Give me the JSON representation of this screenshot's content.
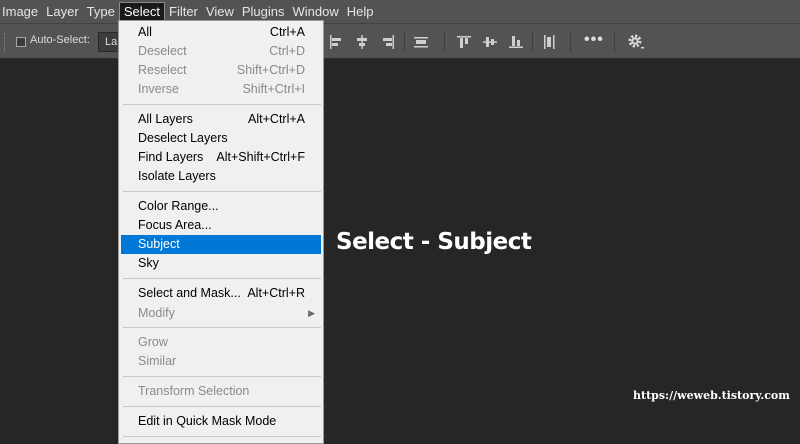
{
  "menubar": {
    "items": [
      "Image",
      "Layer",
      "Type",
      "Select",
      "Filter",
      "View",
      "Plugins",
      "Window",
      "Help"
    ],
    "active": "Select"
  },
  "options_bar": {
    "auto_select_label": "Auto-Select:",
    "auto_select_checked": false,
    "target_dropdown_value": "La",
    "more_label": "•••",
    "icons": [
      "align-left-edges-icon",
      "align-horizontal-centers-icon",
      "align-right-edges-icon",
      "distribute-horizontal-icon",
      "align-top-edges-icon",
      "align-vertical-centers-icon",
      "align-bottom-edges-icon",
      "distribute-vertical-icon",
      "more-icon",
      "gear-icon"
    ]
  },
  "select_menu": {
    "items": [
      {
        "label": "All",
        "shortcut": "Ctrl+A",
        "disabled": false
      },
      {
        "label": "Deselect",
        "shortcut": "Ctrl+D",
        "disabled": true
      },
      {
        "label": "Reselect",
        "shortcut": "Shift+Ctrl+D",
        "disabled": true
      },
      {
        "label": "Inverse",
        "shortcut": "Shift+Ctrl+I",
        "disabled": true
      },
      {
        "label": "All Layers",
        "shortcut": "Alt+Ctrl+A",
        "disabled": false
      },
      {
        "label": "Deselect Layers",
        "shortcut": "",
        "disabled": false
      },
      {
        "label": "Find Layers",
        "shortcut": "Alt+Shift+Ctrl+F",
        "disabled": false
      },
      {
        "label": "Isolate Layers",
        "shortcut": "",
        "disabled": false
      },
      {
        "label": "Color Range...",
        "shortcut": "",
        "disabled": false
      },
      {
        "label": "Focus Area...",
        "shortcut": "",
        "disabled": false
      },
      {
        "label": "Subject",
        "shortcut": "",
        "disabled": false,
        "highlighted": true
      },
      {
        "label": "Sky",
        "shortcut": "",
        "disabled": false
      },
      {
        "label": "Select and Mask...",
        "shortcut": "Alt+Ctrl+R",
        "disabled": false
      },
      {
        "label": "Modify",
        "shortcut": "",
        "disabled": true,
        "submenu": true
      },
      {
        "label": "Grow",
        "shortcut": "",
        "disabled": true
      },
      {
        "label": "Similar",
        "shortcut": "",
        "disabled": true
      },
      {
        "label": "Transform Selection",
        "shortcut": "",
        "disabled": true
      },
      {
        "label": "Edit in Quick Mask Mode",
        "shortcut": "",
        "disabled": false
      }
    ],
    "highlight_color": "#0078d7"
  },
  "caption": "Select - Subject",
  "watermark": "https://weweb.tistory.com"
}
